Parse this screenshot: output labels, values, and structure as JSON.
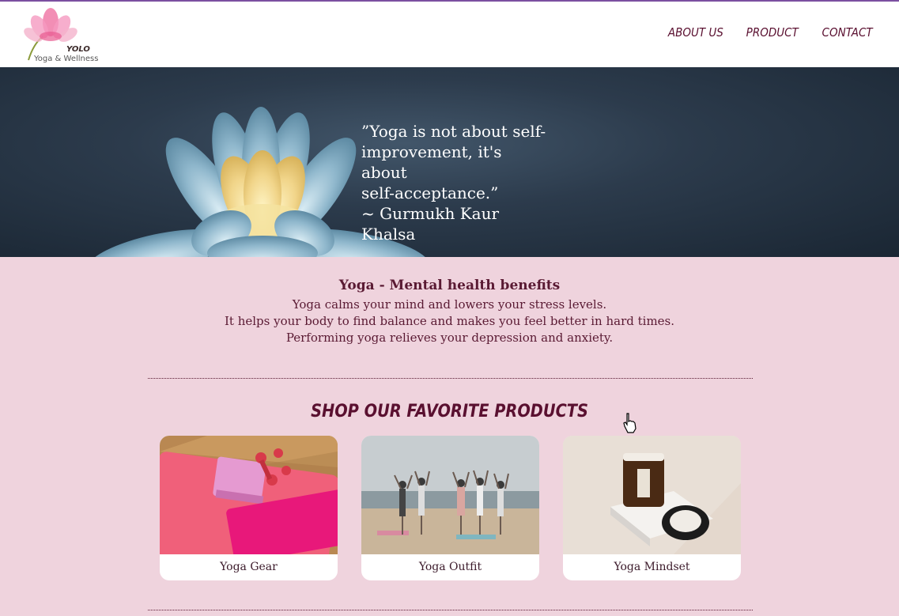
{
  "header": {
    "logo_name": "YOLO",
    "logo_tagline": "Yoga & Wellness",
    "nav": [
      "ABOUT US",
      "PRODUCT",
      "CONTACT"
    ]
  },
  "hero": {
    "quote_lines": [
      "”Yoga is not about self-",
      "improvement, it's about",
      "self-acceptance.”"
    ],
    "author": "~ Gurmukh Kaur Khalsa"
  },
  "benefits": {
    "title": "Yoga - Mental health benefits",
    "lines": [
      "Yoga calms your mind and lowers your stress levels.",
      "It helps your body to find balance and makes you feel better in hard times.",
      "Performing yoga relieves your depression and anxiety."
    ]
  },
  "shop": {
    "title": "SHOP OUR FAVORITE PRODUCTS",
    "products": [
      {
        "label": "Yoga Gear"
      },
      {
        "label": "Yoga Outfit"
      },
      {
        "label": "Yoga Mindset"
      }
    ]
  },
  "colors": {
    "page_bg": "#efd3dd",
    "accent_text": "#5a1a33",
    "top_border": "#7b4fa0"
  }
}
